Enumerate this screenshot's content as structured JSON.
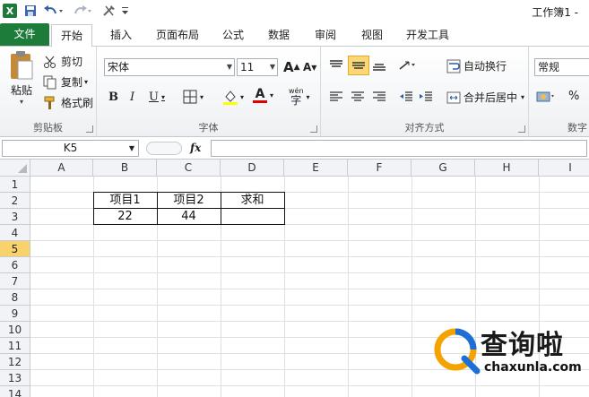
{
  "titlebar": {
    "app_logo": "X",
    "window_title": "工作簿1 -"
  },
  "tabs": [
    "文件",
    "开始",
    "插入",
    "页面布局",
    "公式",
    "数据",
    "审阅",
    "视图",
    "开发工具"
  ],
  "clipboard": {
    "paste": "粘贴",
    "cut": "剪切",
    "copy": "复制",
    "format_painter": "格式刷",
    "group": "剪贴板"
  },
  "font": {
    "name": "宋体",
    "size": "11",
    "grow": "A",
    "shrink": "A",
    "bold": "B",
    "italic": "I",
    "underline": "U",
    "font_color_letter": "A",
    "phonetic": "wén",
    "group": "字体"
  },
  "alignment": {
    "wrap": "自动换行",
    "merge": "合并后居中",
    "group": "对齐方式"
  },
  "number": {
    "format": "常规",
    "percent": "%",
    "group": "数字"
  },
  "formula": {
    "namebox": "K5",
    "fx": "fx"
  },
  "columns": [
    "A",
    "B",
    "C",
    "D",
    "E",
    "F",
    "G",
    "H",
    "I"
  ],
  "rows": [
    "1",
    "2",
    "3",
    "4",
    "5",
    "6",
    "7",
    "8",
    "9",
    "10",
    "11",
    "12",
    "13",
    "14"
  ],
  "selected_row": "5",
  "cells": {
    "B2": "项目1",
    "C2": "项目2",
    "D2": "求和",
    "B3": "22",
    "C3": "44"
  },
  "watermark": {
    "brand": "查询啦",
    "url": "chaxunla.com"
  },
  "colors": {
    "file_tab": "#1e7c3b",
    "row_select": "#f8d26a",
    "watermark_blue": "#1d6fd8",
    "watermark_orange": "#f5a300"
  }
}
